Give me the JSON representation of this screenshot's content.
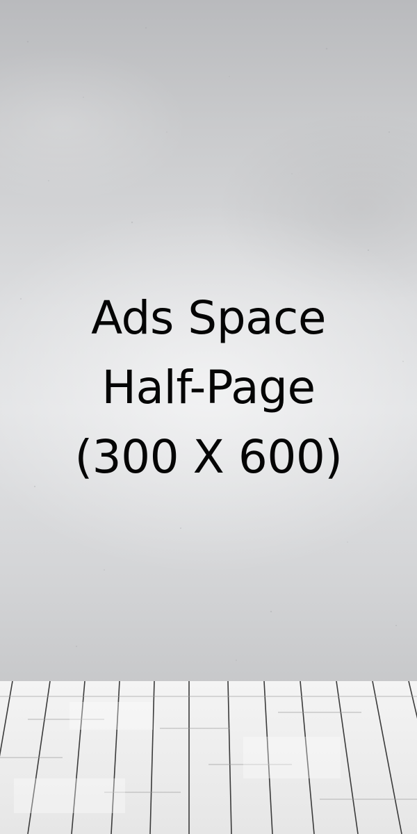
{
  "ad": {
    "line1": "Ads Space",
    "line2": "Half-Page",
    "line3": "(300 X 600)"
  },
  "colors": {
    "text": "#050505",
    "wall": "#d6d7d9",
    "floor": "#eeeeee"
  }
}
